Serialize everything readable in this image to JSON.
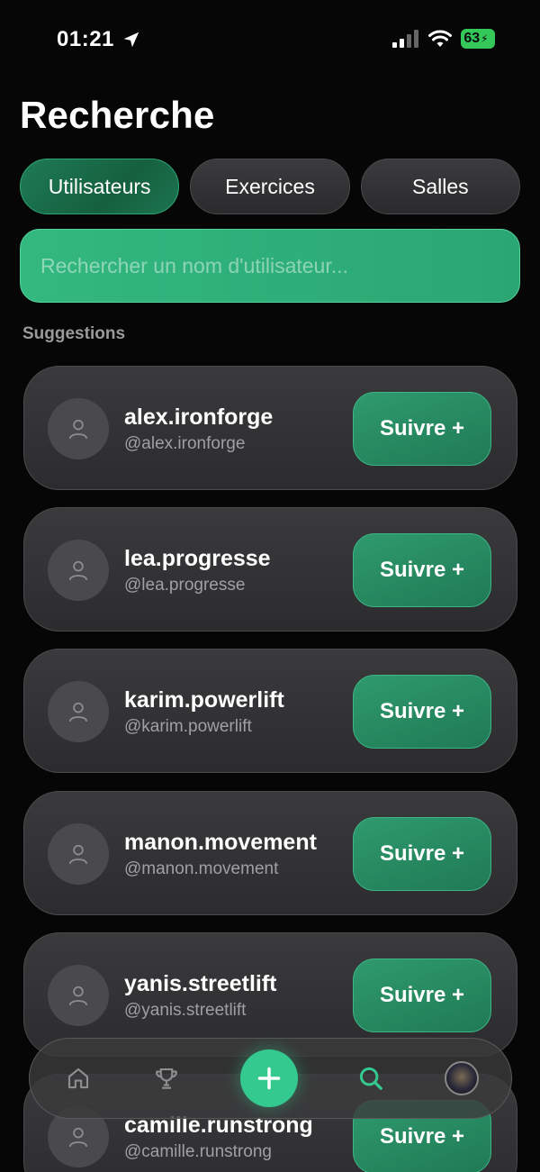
{
  "status_bar": {
    "time": "01:21",
    "battery": "63"
  },
  "page": {
    "title": "Recherche"
  },
  "tabs": [
    {
      "label": "Utilisateurs",
      "active": true
    },
    {
      "label": "Exercices",
      "active": false
    },
    {
      "label": "Salles",
      "active": false
    }
  ],
  "search": {
    "placeholder": "Rechercher un nom d'utilisateur...",
    "value": ""
  },
  "suggestions": {
    "label": "Suggestions",
    "users": [
      {
        "name": "alex.ironforge",
        "handle": "@alex.ironforge",
        "follow_label": "Suivre +"
      },
      {
        "name": "lea.progresse",
        "handle": "@lea.progresse",
        "follow_label": "Suivre +"
      },
      {
        "name": "karim.powerlift",
        "handle": "@karim.powerlift",
        "follow_label": "Suivre +"
      },
      {
        "name": "manon.movement",
        "handle": "@manon.movement",
        "follow_label": "Suivre +"
      },
      {
        "name": "yanis.streetlift",
        "handle": "@yanis.streetlift",
        "follow_label": "Suivre +"
      },
      {
        "name": "camille.runstrong",
        "handle": "@camille.runstrong",
        "follow_label": "Suivre +"
      }
    ]
  },
  "bottom_nav": {
    "items": [
      "home-icon",
      "trophy-icon",
      "plus-icon",
      "search-icon",
      "profile-avatar"
    ],
    "active": "search-icon"
  },
  "colors": {
    "accent": "#34c98f",
    "tab_active": "#1f7a55",
    "search_bg": "#2fb079",
    "card_bg": "#333335",
    "background": "#060606"
  }
}
